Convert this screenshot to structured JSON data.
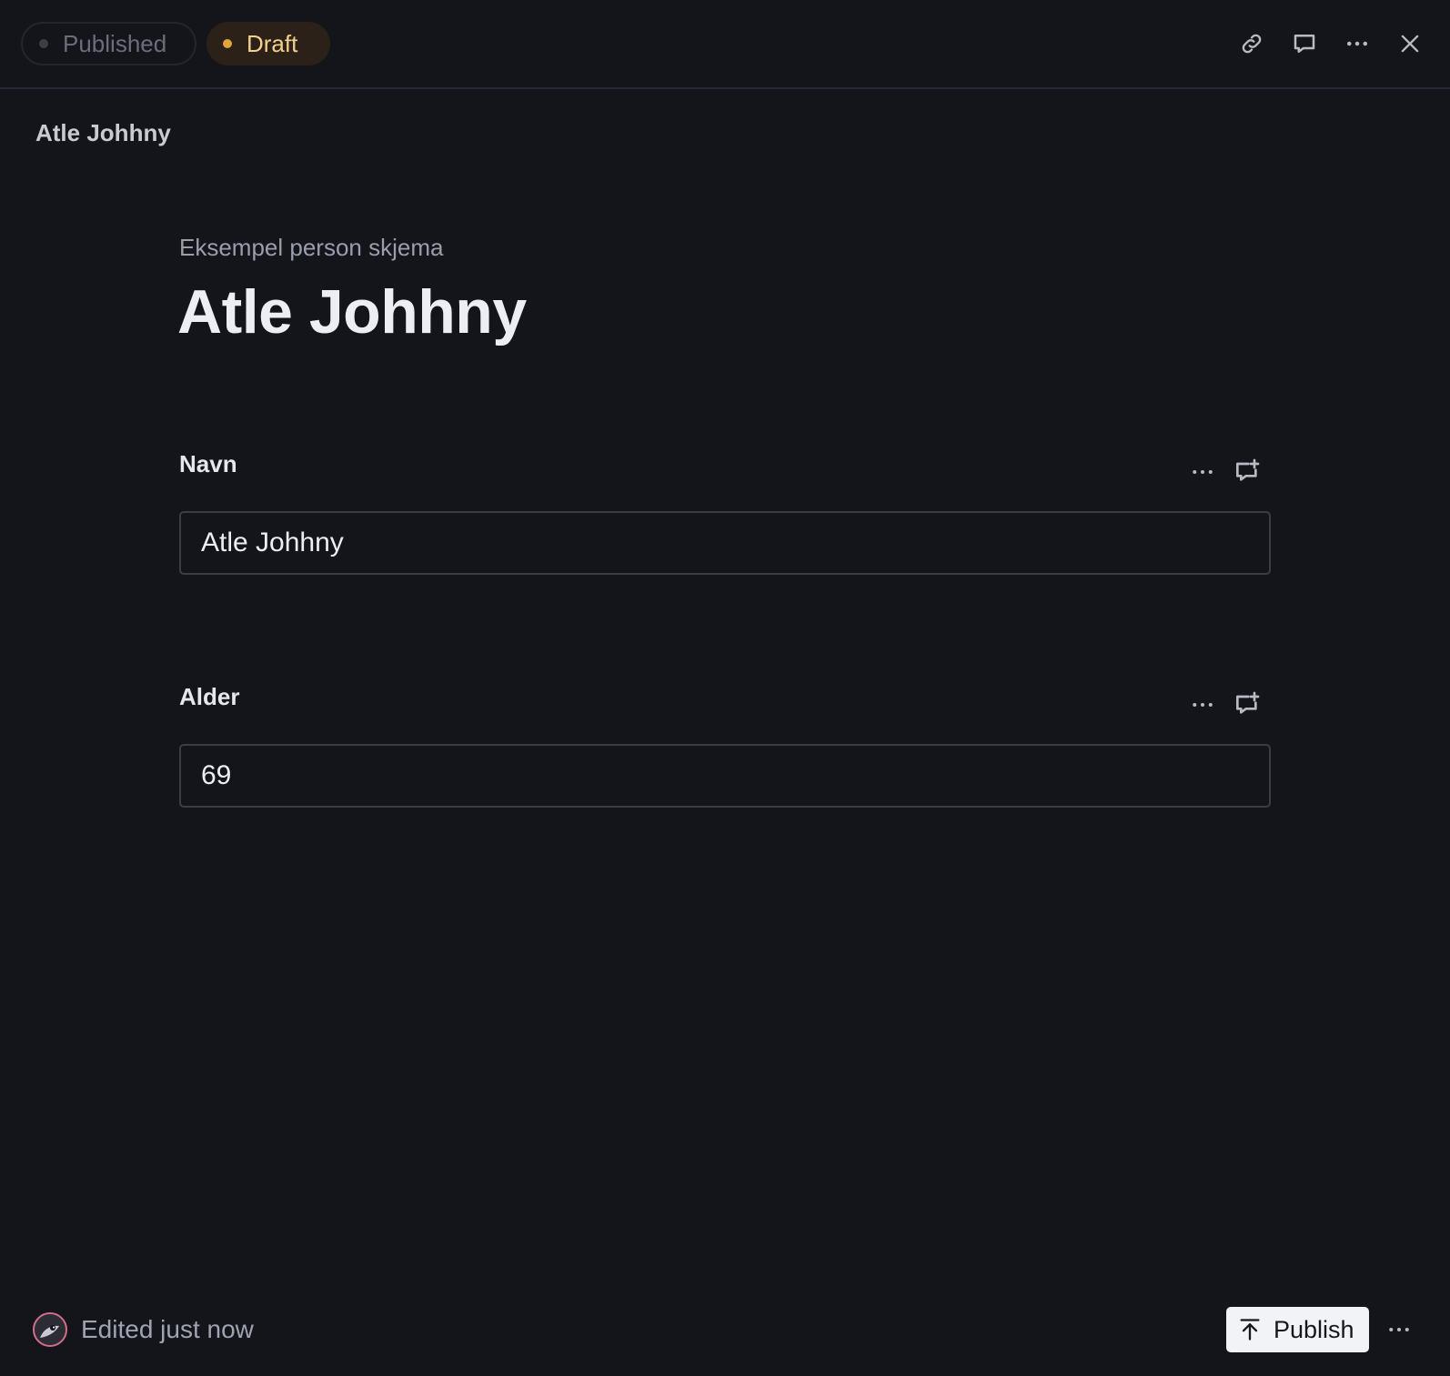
{
  "header": {
    "tabs": [
      {
        "label": "Published",
        "state": "inactive"
      },
      {
        "label": "Draft",
        "state": "active"
      }
    ],
    "actions": [
      {
        "name": "link-icon"
      },
      {
        "name": "comment-icon"
      },
      {
        "name": "more-icon"
      },
      {
        "name": "close-icon"
      }
    ]
  },
  "breadcrumb": {
    "title": "Atle Johhny"
  },
  "document": {
    "schema_label": "Eksempel person skjema",
    "title": "Atle Johhny",
    "fields": [
      {
        "label": "Navn",
        "value": "Atle Johhny"
      },
      {
        "label": "Alder",
        "value": "69"
      }
    ]
  },
  "footer": {
    "status": "Edited just now",
    "publish_label": "Publish"
  },
  "colors": {
    "background": "#14151b",
    "draft_accent": "#e0a43f",
    "draft_text": "#f3d18b",
    "border": "#3a3c48"
  }
}
